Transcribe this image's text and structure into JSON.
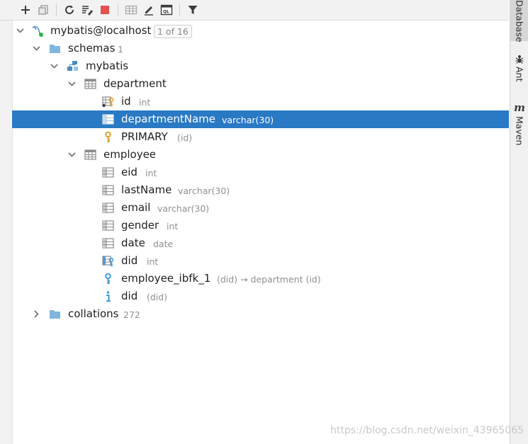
{
  "toolbar": {
    "buttons": [
      {
        "name": "add-icon"
      },
      {
        "name": "duplicate-icon"
      },
      {
        "name": "refresh-icon"
      },
      {
        "name": "properties-icon"
      },
      {
        "name": "stop-icon"
      },
      {
        "name": "table-view-icon"
      },
      {
        "name": "edit-icon"
      },
      {
        "name": "query-console-icon"
      },
      {
        "name": "filter-icon"
      }
    ]
  },
  "tree": {
    "connection": {
      "label": "mybatis@localhost",
      "badge": "1 of 16"
    },
    "schemas": {
      "label": "schemas",
      "count": "1"
    },
    "schema": {
      "label": "mybatis"
    },
    "department": {
      "label": "department",
      "items": [
        {
          "label": "id",
          "hint": "int"
        },
        {
          "label": "departmentName",
          "hint": "varchar(30)"
        },
        {
          "label": "PRIMARY",
          "hint": "(id)"
        }
      ]
    },
    "employee": {
      "label": "employee",
      "items": [
        {
          "label": "eid",
          "hint": "int"
        },
        {
          "label": "lastName",
          "hint": "varchar(30)"
        },
        {
          "label": "email",
          "hint": "varchar(30)"
        },
        {
          "label": "gender",
          "hint": "int"
        },
        {
          "label": "date",
          "hint": "date"
        },
        {
          "label": "did",
          "hint": "int"
        },
        {
          "label": "employee_ibfk_1",
          "hint": "(did) → department (id)"
        },
        {
          "label": "did",
          "hint": "(did)"
        }
      ]
    },
    "collations": {
      "label": "collations",
      "count": "272"
    }
  },
  "right_tabs": [
    {
      "label": "Database"
    },
    {
      "label": "Ant"
    },
    {
      "label": "Maven"
    }
  ],
  "watermark": "https://blog.csdn.net/weixin_43965065",
  "colors": {
    "selection": "#2a79c4",
    "folder": "#7fb6de",
    "text": "#1f1f1f",
    "hint": "#8f8f8f"
  }
}
